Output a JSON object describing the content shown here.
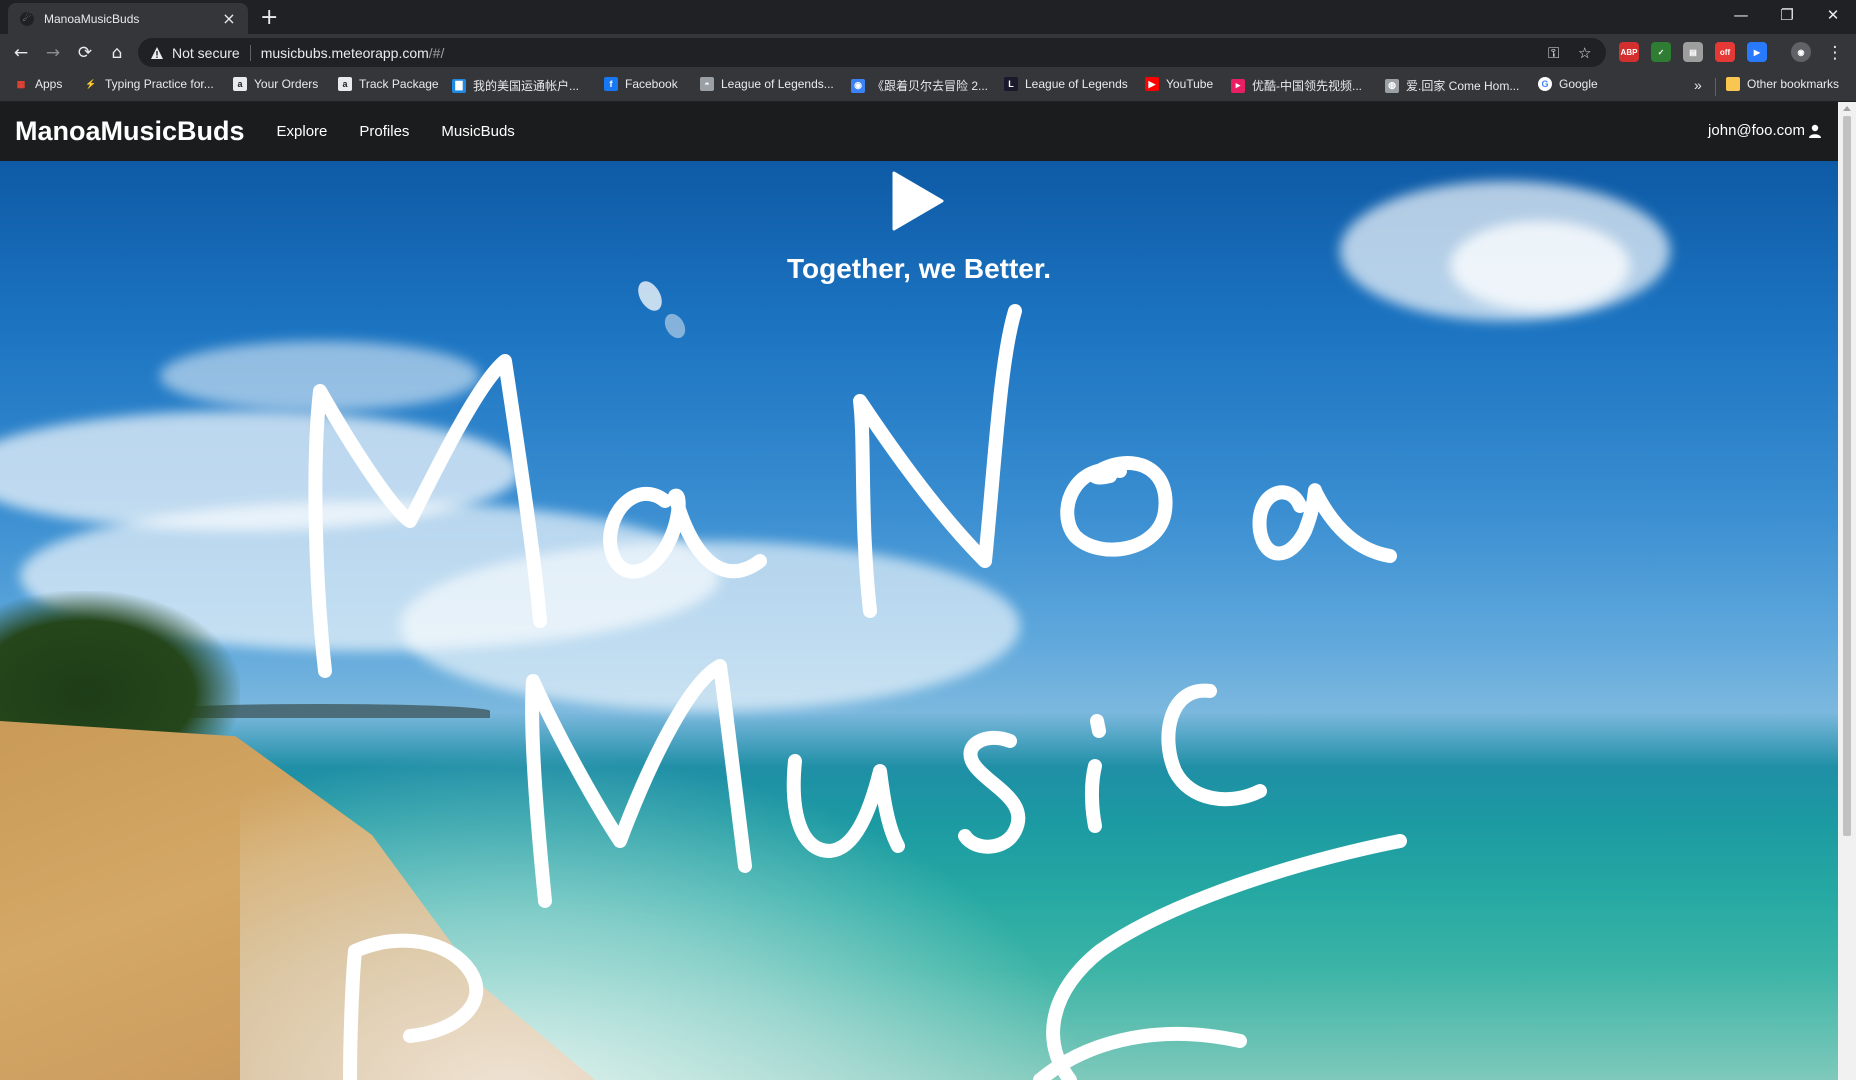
{
  "browser": {
    "tab_title": "ManoaMusicBuds",
    "not_secure": "Not secure",
    "url_host": "musicbubs.meteorapp.com",
    "url_path": "/#/",
    "bookmarks": [
      {
        "label": "Apps",
        "icon": "apps-grid-icon",
        "color": "#4285f4"
      },
      {
        "label": "Typing Practice for...",
        "icon": "bolt-icon",
        "color": "#5f6368"
      },
      {
        "label": "Your Orders",
        "icon": "amazon-icon",
        "color": "#e8eaed"
      },
      {
        "label": "Track Package",
        "icon": "amazon-icon",
        "color": "#e8eaed"
      },
      {
        "label": "我的美国运通帐户...",
        "icon": "amex-icon",
        "color": "#1e88e5"
      },
      {
        "label": "Facebook",
        "icon": "facebook-icon",
        "color": "#1877f2"
      },
      {
        "label": "League of Legends...",
        "icon": "lol-icon",
        "color": "#9aa0a6"
      },
      {
        "label": "《跟着贝尔去冒险 2...",
        "icon": "video-icon",
        "color": "#3b82f6"
      },
      {
        "label": "League of Legends",
        "icon": "lol-l-icon",
        "color": "#1a1a2e"
      },
      {
        "label": "YouTube",
        "icon": "youtube-icon",
        "color": "#ff0000"
      },
      {
        "label": "优酷-中国领先视频...",
        "icon": "youku-icon",
        "color": "#e91e63"
      },
      {
        "label": "爱.回家 Come Hom...",
        "icon": "globe-icon",
        "color": "#9aa0a6"
      },
      {
        "label": "Google",
        "icon": "google-icon",
        "color": "#ffffff"
      }
    ],
    "overflow": "»",
    "other_bookmarks": "Other bookmarks"
  },
  "app": {
    "brand": "ManoaMusicBuds",
    "nav": [
      "Explore",
      "Profiles",
      "MusicBuds"
    ],
    "user": "john@foo.com"
  },
  "hero": {
    "tagline": "Together, we Better.",
    "handwritten": "MaNoa Music Buds"
  }
}
